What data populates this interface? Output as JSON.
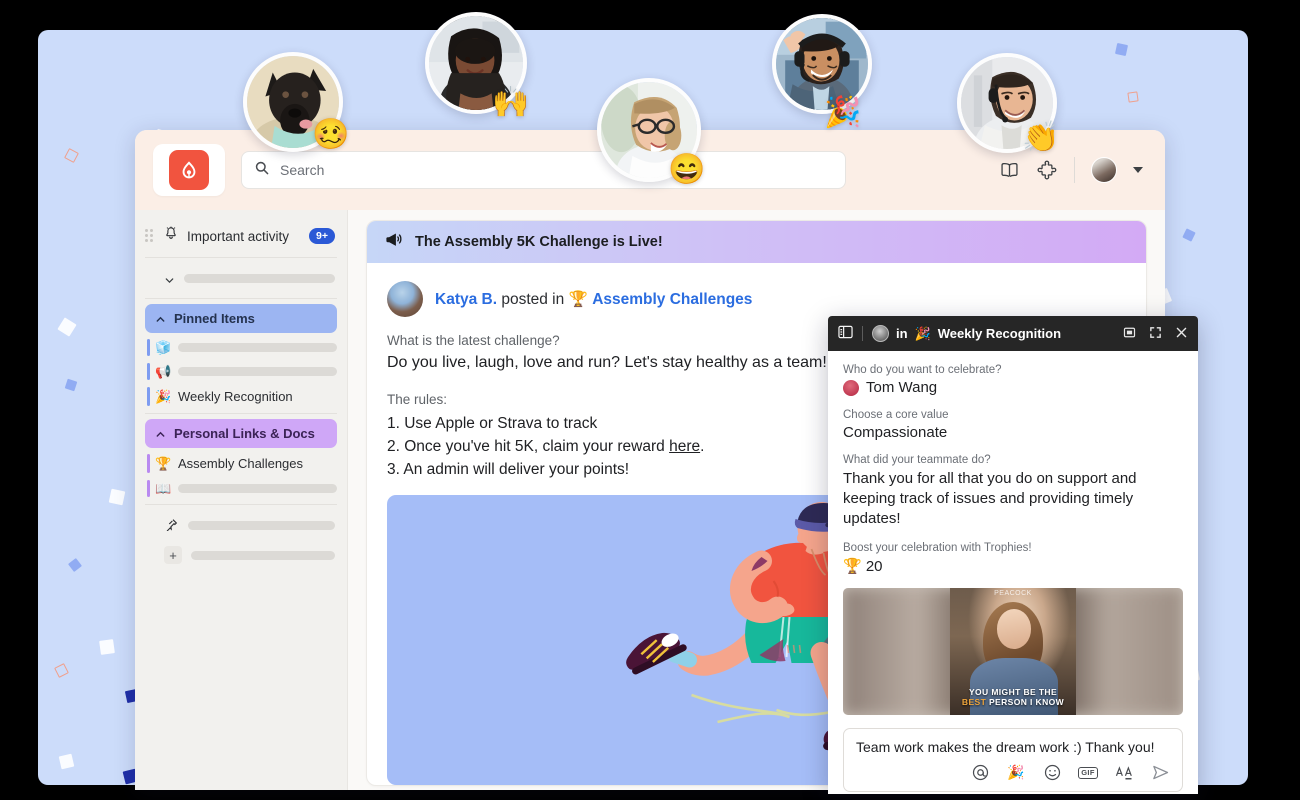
{
  "app": {
    "logo_icon": "assembly-logo-icon",
    "search": {
      "placeholder": "Search",
      "icon": "search-icon"
    },
    "header_icons": [
      {
        "name": "book-icon",
        "label": "Knowledge Center"
      },
      {
        "name": "puzzle-piece-icon",
        "label": "Integrations"
      }
    ],
    "avatar_name": "user-avatar",
    "caret_name": "chevron-down-icon"
  },
  "sidebar": {
    "important_activity": {
      "label": "Important activity",
      "badge": "9+",
      "icon": "bell-activity-icon"
    },
    "collapsed_row_icon": "chevron-down-icon",
    "groups": [
      {
        "label": "Pinned Items",
        "color": "#9cb5f2",
        "chevron": "chevron-up-icon",
        "items": [
          {
            "emoji": "🧊",
            "label": "",
            "skeleton": true
          },
          {
            "emoji": "📢",
            "label": "",
            "skeleton": true
          },
          {
            "emoji": "🎉",
            "label": "Weekly Recognition",
            "skeleton": false
          }
        ]
      },
      {
        "label": "Personal Links & Docs",
        "color": "#cfa7f7",
        "chevron": "chevron-up-icon",
        "items": [
          {
            "emoji": "🏆",
            "label": "Assembly Challenges",
            "skeleton": false
          },
          {
            "emoji": "📖",
            "label": "",
            "skeleton": true
          }
        ]
      }
    ],
    "footer_rows": [
      {
        "icon": "pin-icon",
        "label": "",
        "skeleton": true
      },
      {
        "icon": "plus-icon",
        "label": "",
        "skeleton": true
      }
    ]
  },
  "main": {
    "announcement": {
      "icon": "megaphone-icon",
      "text": "The Assembly 5K Challenge is Live!"
    },
    "post": {
      "avatar_name": "author-avatar",
      "author": "Katya B.",
      "posted_in": " posted in ",
      "flow_emoji": "🏆",
      "channel": "Assembly Challenges",
      "question": "What is the latest challenge?",
      "answer": "Do you live, laugh, love and run? Let's stay healthy as a team!",
      "rules_label": "The rules:",
      "rules": [
        "1. Use Apple or Strava to track",
        "2. Once you've hit 5K, claim your reward ",
        "3. An admin will deliver your points!"
      ],
      "rule2_link": "here",
      "rule2_tail": ".",
      "hero_name": "runner-illustration"
    }
  },
  "modal": {
    "header": {
      "panel_icon": "sidebar-panel-icon",
      "avatar_name": "poster-avatar",
      "in_text": "in",
      "channel_emoji": "🎉",
      "channel": "Weekly Recognition",
      "actions": [
        {
          "name": "minimize-icon"
        },
        {
          "name": "expand-icon"
        },
        {
          "name": "close-icon"
        }
      ]
    },
    "fields": [
      {
        "label": "Who do you want to celebrate?",
        "value": "Tom Wang",
        "type": "person"
      },
      {
        "label": "Choose a core value",
        "value": "Compassionate",
        "type": "text"
      },
      {
        "label": "What did your teammate do?",
        "value": "Thank you for all that you do on support and keeping track of issues and providing timely updates!",
        "type": "long"
      },
      {
        "label": "Boost your celebration with Trophies!",
        "value": "🏆 20",
        "type": "text"
      }
    ],
    "gif": {
      "name": "celebration-gif-preview",
      "brand": "PEACOCK",
      "caption_line1": "YOU MIGHT BE THE",
      "caption_highlight": "BEST",
      "caption_line2": " PERSON I KNOW"
    },
    "composer": {
      "message": "Team work makes the dream work :) Thank you!",
      "tools": [
        {
          "name": "mention-icon",
          "glyph": "@"
        },
        {
          "name": "add-celebration-icon",
          "glyph": "🎉"
        },
        {
          "name": "emoji-icon",
          "glyph": "☺"
        },
        {
          "name": "gif-icon",
          "glyph": "GIF"
        },
        {
          "name": "text-format-icon",
          "glyph": "AA"
        },
        {
          "name": "send-icon",
          "glyph": "➤"
        }
      ]
    }
  },
  "floating_avatars": [
    {
      "name": "avatar-dog",
      "emoji": "🥴"
    },
    {
      "name": "avatar-woman-1",
      "emoji": "🙌"
    },
    {
      "name": "avatar-woman-glasses",
      "emoji": "😄"
    },
    {
      "name": "avatar-man-headset",
      "emoji": "🎉"
    },
    {
      "name": "avatar-man-support",
      "emoji": "👏"
    }
  ],
  "colors": {
    "backdrop": "#ccdcfa",
    "brand_red": "#f1543f",
    "header_peach": "#fbeee6",
    "badge_blue": "#2b59d6",
    "pinned_blue": "#9cb5f2",
    "personal_purple": "#cfa7f7",
    "link_blue": "#2b6de0",
    "hero_blue": "#a5bdf7",
    "modal_header": "#262626",
    "confetti_navy": "#1f2fa8",
    "confetti_blue": "#7e9cf0",
    "confetti_coral": "#f0a08c",
    "confetti_white": "#ffffff"
  }
}
